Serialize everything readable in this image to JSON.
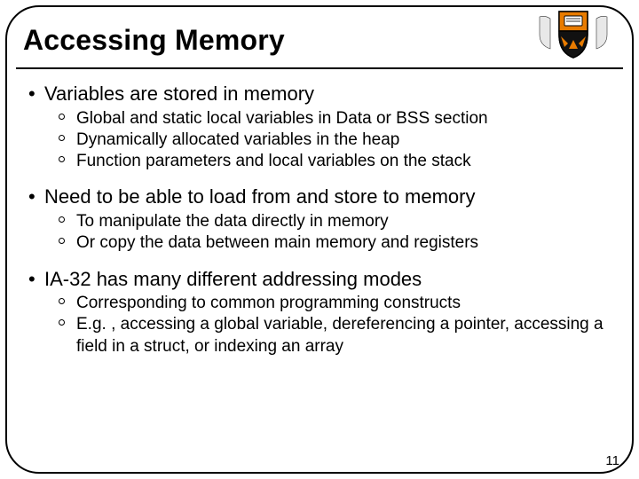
{
  "title": "Accessing Memory",
  "logo_name": "princeton-shield-crest",
  "sections": [
    {
      "heading": "Variables are stored in memory",
      "items": [
        "Global and static local variables in Data or BSS section",
        "Dynamically allocated variables in the heap",
        "Function parameters and local variables on the stack"
      ]
    },
    {
      "heading": "Need to be able to load from and store to memory",
      "items": [
        "To manipulate the data directly in memory",
        "Or copy the data between main memory and registers"
      ]
    },
    {
      "heading": "IA-32 has many different addressing modes",
      "items": [
        "Corresponding to common programming constructs",
        "E.g. , accessing a global variable, dereferencing a pointer, accessing a field in a struct, or indexing an array"
      ]
    }
  ],
  "page_number": "11"
}
